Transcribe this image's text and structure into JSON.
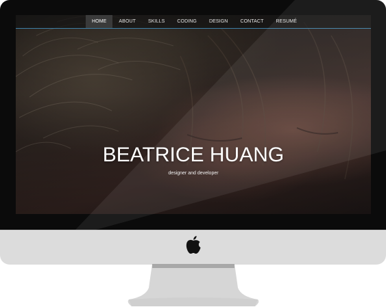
{
  "nav": {
    "items": [
      {
        "label": "HOME",
        "active": true
      },
      {
        "label": "ABOUT",
        "active": false
      },
      {
        "label": "SKILLS",
        "active": false
      },
      {
        "label": "CODING",
        "active": false
      },
      {
        "label": "DESIGN",
        "active": false
      },
      {
        "label": "CONTACT",
        "active": false
      },
      {
        "label": "RESUMÉ",
        "active": false
      }
    ]
  },
  "hero": {
    "title": "BEATRICE HUANG",
    "subtitle": "designer and developer"
  },
  "colors": {
    "nav_background": "#141414",
    "nav_active": "#3a3a3a",
    "nav_underline": "#3d7fa6",
    "monitor_bezel": "#0b0b0b",
    "monitor_chin": "#dcdcdc",
    "stand": "#d4d4d4"
  },
  "icons": {
    "brand": "apple-logo-icon"
  }
}
